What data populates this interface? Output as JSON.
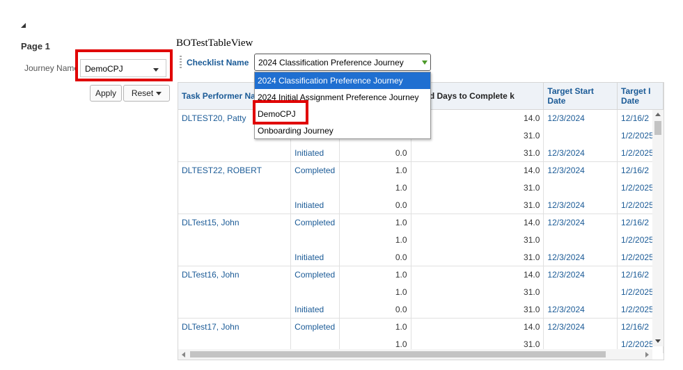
{
  "page": {
    "title": "Page 1"
  },
  "journey_prompt": {
    "label": "Journey Name",
    "value": "DemoCPJ"
  },
  "buttons": {
    "apply": "Apply",
    "reset": "Reset"
  },
  "view": {
    "title": "BOTestTableView"
  },
  "checklist_prompt": {
    "label": "Checklist Name",
    "value": "2024 Classification Preference Journey",
    "options": [
      "2024 Classification Preference Journey",
      "2024 Initial Assignment Preference Journey",
      "DemoCPJ",
      "Onboarding Journey"
    ]
  },
  "table": {
    "headers": [
      "Task Performer Na",
      "",
      "",
      "nned Days to Complete k",
      "Target Start Date",
      "Target I Date"
    ],
    "rows": [
      [
        "DLTEST20, Patty",
        "",
        "",
        "14.0",
        "12/3/2024",
        "12/16/2"
      ],
      [
        "",
        "",
        "",
        "31.0",
        "",
        "1/2/2025"
      ],
      [
        "",
        "Initiated",
        "0.0",
        "31.0",
        "12/3/2024",
        "1/2/2025"
      ],
      [
        "DLTEST22, ROBERT",
        "Completed",
        "1.0",
        "14.0",
        "12/3/2024",
        "12/16/2"
      ],
      [
        "",
        "",
        "1.0",
        "31.0",
        "",
        "1/2/2025"
      ],
      [
        "",
        "Initiated",
        "0.0",
        "31.0",
        "12/3/2024",
        "1/2/2025"
      ],
      [
        "DLTest15, John",
        "Completed",
        "1.0",
        "14.0",
        "12/3/2024",
        "12/16/2"
      ],
      [
        "",
        "",
        "1.0",
        "31.0",
        "",
        "1/2/2025"
      ],
      [
        "",
        "Initiated",
        "0.0",
        "31.0",
        "12/3/2024",
        "1/2/2025"
      ],
      [
        "DLTest16, John",
        "Completed",
        "1.0",
        "14.0",
        "12/3/2024",
        "12/16/2"
      ],
      [
        "",
        "",
        "1.0",
        "31.0",
        "",
        "1/2/2025"
      ],
      [
        "",
        "Initiated",
        "0.0",
        "31.0",
        "12/3/2024",
        "1/2/2025"
      ],
      [
        "DLTest17, John",
        "Completed",
        "1.0",
        "14.0",
        "12/3/2024",
        "12/16/2"
      ],
      [
        "",
        "",
        "1.0",
        "31.0",
        "",
        "1/2/2025"
      ]
    ]
  },
  "colors": {
    "link": "#1a5a96",
    "highlight": "#e00000",
    "selected_option": "#1f6fd1"
  },
  "icons": {
    "collapse": "triangle-collapse-icon",
    "dropdown": "chevron-down-icon",
    "scroll_up": "arrow-up-icon",
    "scroll_down": "arrow-down-icon",
    "scroll_left": "arrow-left-icon",
    "scroll_right": "arrow-right-icon"
  }
}
